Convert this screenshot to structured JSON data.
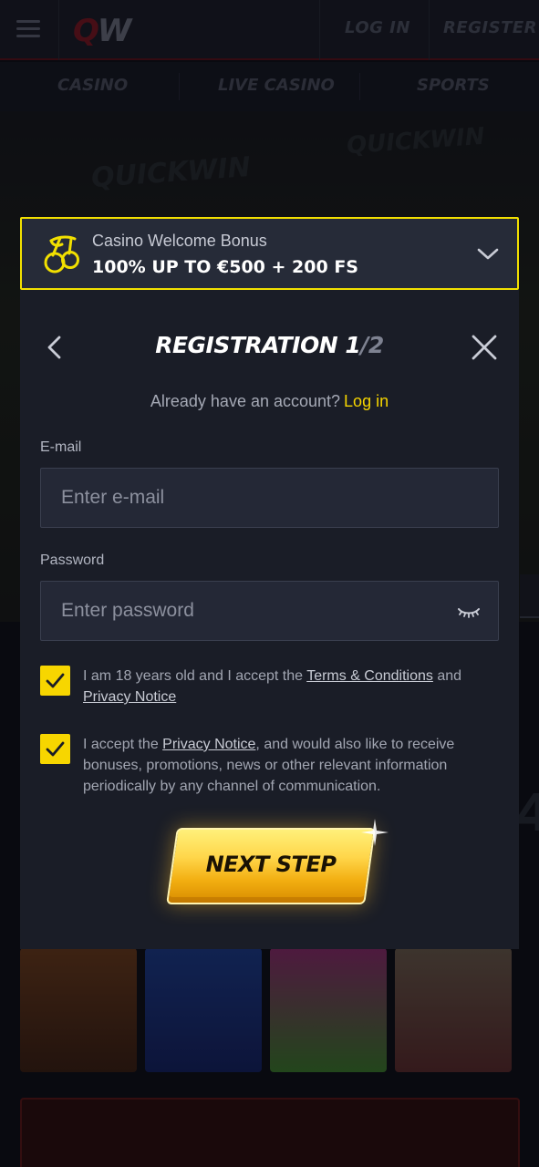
{
  "header": {
    "login_label": "LOG IN",
    "register_label": "REGISTER"
  },
  "nav": {
    "items": [
      "CASINO",
      "LIVE CASINO",
      "SPORTS"
    ]
  },
  "background": {
    "hero_watermark": "QUICKWIN"
  },
  "bonus": {
    "subtitle": "Casino Welcome Bonus",
    "title": "100% UP TO €500 + 200 FS",
    "accent_color": "#f2e000"
  },
  "modal": {
    "title_main": "REGISTRATION 1",
    "title_slash": "/",
    "title_total": "2",
    "already_text": "Already have an account?",
    "login_link": "Log in",
    "email": {
      "label": "E-mail",
      "placeholder": "Enter e-mail",
      "value": ""
    },
    "password": {
      "label": "Password",
      "placeholder": "Enter password",
      "value": ""
    },
    "consent_age": {
      "checked": true,
      "text_before": "I am 18 years old and I accept the ",
      "terms_link": "Terms & Conditions",
      "text_mid": " and",
      "privacy_link": "Privacy Notice"
    },
    "consent_marketing": {
      "checked": true,
      "text_before": "I accept the ",
      "privacy_link": "Privacy Notice",
      "text_after": ", and would also like to receive bonuses, promotions, news or other relevant information periodically by any channel of communication."
    },
    "next_button": "NEXT STEP"
  },
  "colors": {
    "brand_yellow": "#f5d400",
    "modal_bg": "#1a1d27",
    "field_bg": "#242836"
  }
}
